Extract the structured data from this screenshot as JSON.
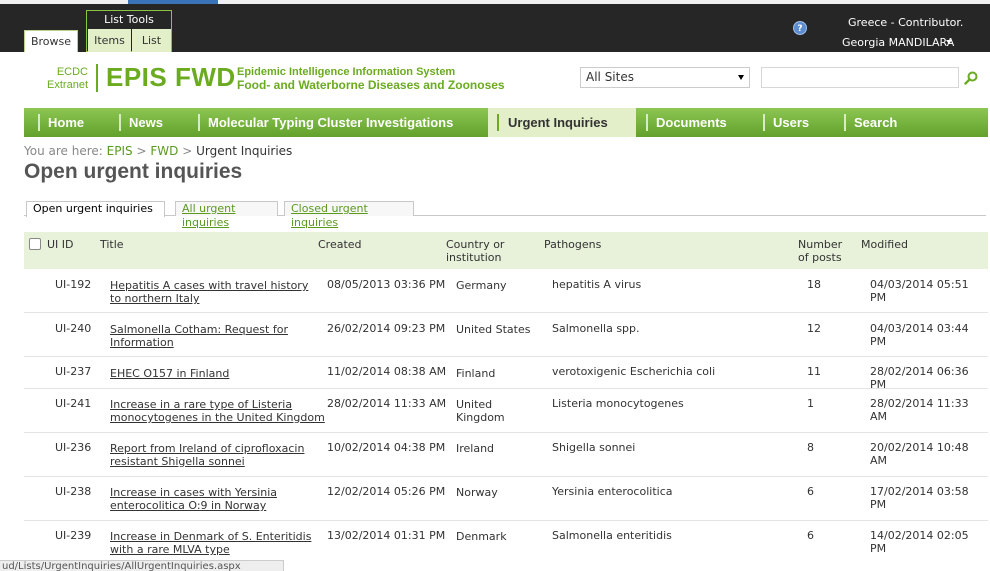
{
  "ribbon": {
    "browse_tab": "Browse",
    "list_tools_title": "List Tools",
    "items_tab": "Items",
    "list_tab": "List"
  },
  "user": {
    "site": "Greece - Contributor.",
    "name": "Georgia MANDILARA"
  },
  "logo": {
    "org_line1": "ECDC",
    "org_line2": "Extranet",
    "name": "EPIS FWD",
    "subtitle1": "Epidemic Intelligence Information System",
    "subtitle2": "Food- and Waterborne Diseases and Zoonoses",
    "color": "#6aab1f"
  },
  "search": {
    "scope": "All Sites",
    "value": ""
  },
  "nav": {
    "items": [
      {
        "label": "Home"
      },
      {
        "label": "News"
      },
      {
        "label": "Molecular Typing Cluster Investigations"
      },
      {
        "label": "Urgent Inquiries"
      },
      {
        "label": "Documents"
      },
      {
        "label": "Users"
      },
      {
        "label": "Search"
      }
    ],
    "active": "Urgent Inquiries"
  },
  "breadcrumb": {
    "prefix": "You are here:",
    "items": [
      "EPIS",
      "FWD",
      "Urgent Inquiries"
    ],
    "separator": ">"
  },
  "page_title": "Open urgent inquiries",
  "view_tabs": [
    "Open urgent inquiries",
    "All urgent inquiries",
    "Closed urgent inquiries"
  ],
  "table": {
    "headers": {
      "id": "UI ID",
      "title": "Title",
      "created": "Created",
      "country_l1": "Country or",
      "country_l2": "institution",
      "pathogens": "Pathogens",
      "posts_l1": "Number",
      "posts_l2": "of posts",
      "modified": "Modified"
    },
    "rows": [
      {
        "id": "UI-192",
        "title_l1": "Hepatitis A cases with travel history",
        "title_l2": "to northern Italy",
        "created": "08/05/2013 03:36 PM",
        "country_l1": "Germany",
        "country_l2": "",
        "pathogens": "hepatitis A virus",
        "posts": "18",
        "modified": "04/03/2014 05:51 PM"
      },
      {
        "id": "UI-240",
        "title_l1": "Salmonella Cotham: Request for",
        "title_l2": "Information",
        "created": "26/02/2014 09:23 PM",
        "country_l1": "United States",
        "country_l2": "",
        "pathogens": "Salmonella spp.",
        "posts": "12",
        "modified": "04/03/2014 03:44 PM"
      },
      {
        "id": "UI-237",
        "title_l1": "EHEC O157 in Finland",
        "title_l2": "",
        "created": "11/02/2014 08:38 AM",
        "country_l1": "Finland",
        "country_l2": "",
        "pathogens": "verotoxigenic Escherichia coli",
        "posts": "11",
        "modified": "28/02/2014 06:36 PM"
      },
      {
        "id": "UI-241",
        "title_l1": "Increase in a rare type of Listeria",
        "title_l2": "monocytogenes in the United Kingdom",
        "created": "28/02/2014 11:33 AM",
        "country_l1": "United",
        "country_l2": "Kingdom",
        "pathogens": "Listeria monocytogenes",
        "posts": "1",
        "modified": "28/02/2014 11:33 AM"
      },
      {
        "id": "UI-236",
        "title_l1": "Report from Ireland of ciprofloxacin",
        "title_l2": "resistant Shigella sonnei",
        "created": "10/02/2014 04:38 PM",
        "country_l1": "Ireland",
        "country_l2": "",
        "pathogens": "Shigella sonnei",
        "posts": "8",
        "modified": "20/02/2014 10:48 AM"
      },
      {
        "id": "UI-238",
        "title_l1": "Increase in cases with Yersinia",
        "title_l2": "enterocolitica O:9 in Norway",
        "created": "12/02/2014 05:26 PM",
        "country_l1": "Norway",
        "country_l2": "",
        "pathogens": "Yersinia enterocolitica",
        "posts": "6",
        "modified": "17/02/2014 03:58 PM"
      },
      {
        "id": "UI-239",
        "title_l1": "Increase in Denmark of S. Enteritidis",
        "title_l2": "with a rare MLVA type",
        "created": "13/02/2014 01:31 PM",
        "country_l1": "Denmark",
        "country_l2": "",
        "pathogens": "Salmonella enteritidis",
        "posts": "6",
        "modified": "14/02/2014 02:05 PM"
      }
    ]
  },
  "status_url": "ud/Lists/UrgentInquiries/AllUrgentInquiries.aspx",
  "icons": {
    "help": "help-icon",
    "search": "search-icon",
    "user_menu": "chevron-down-icon",
    "scope_menu": "chevron-down-icon"
  }
}
